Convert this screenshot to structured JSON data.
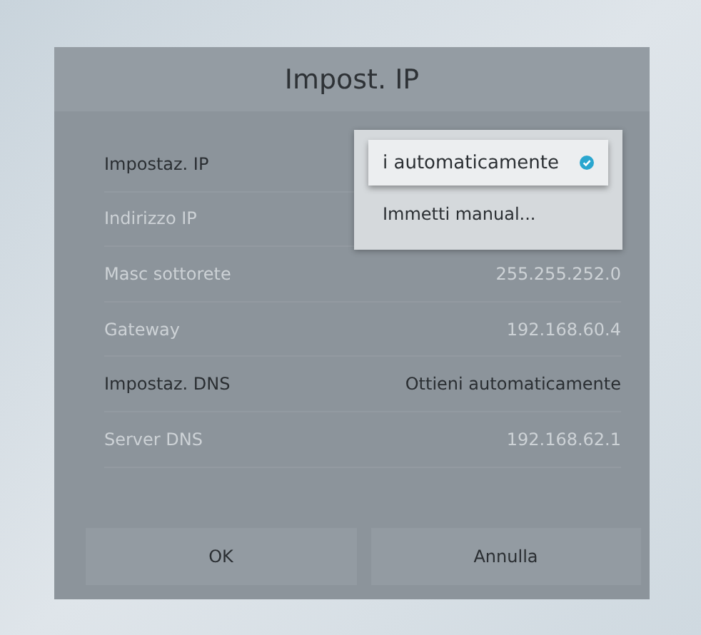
{
  "dialog": {
    "title": "Impost. IP"
  },
  "rows": [
    {
      "label": "Impostaz. IP",
      "disabled": false
    },
    {
      "label": "Indirizzo IP",
      "disabled": true
    },
    {
      "label": "Masc sottorete",
      "value": "255.255.252.0",
      "disabled": true
    },
    {
      "label": "Gateway",
      "value": "192.168.60.4",
      "disabled": true
    },
    {
      "label": "Impostaz. DNS",
      "value": "Ottieni automaticamente",
      "disabled": false
    },
    {
      "label": "Server DNS",
      "value": "192.168.62.1",
      "disabled": true
    }
  ],
  "dropdown": {
    "options": [
      {
        "label": "i automaticamente",
        "selected": true
      },
      {
        "label": "Immetti manual...",
        "selected": false
      }
    ]
  },
  "buttons": [
    "OK",
    "Annulla"
  ]
}
